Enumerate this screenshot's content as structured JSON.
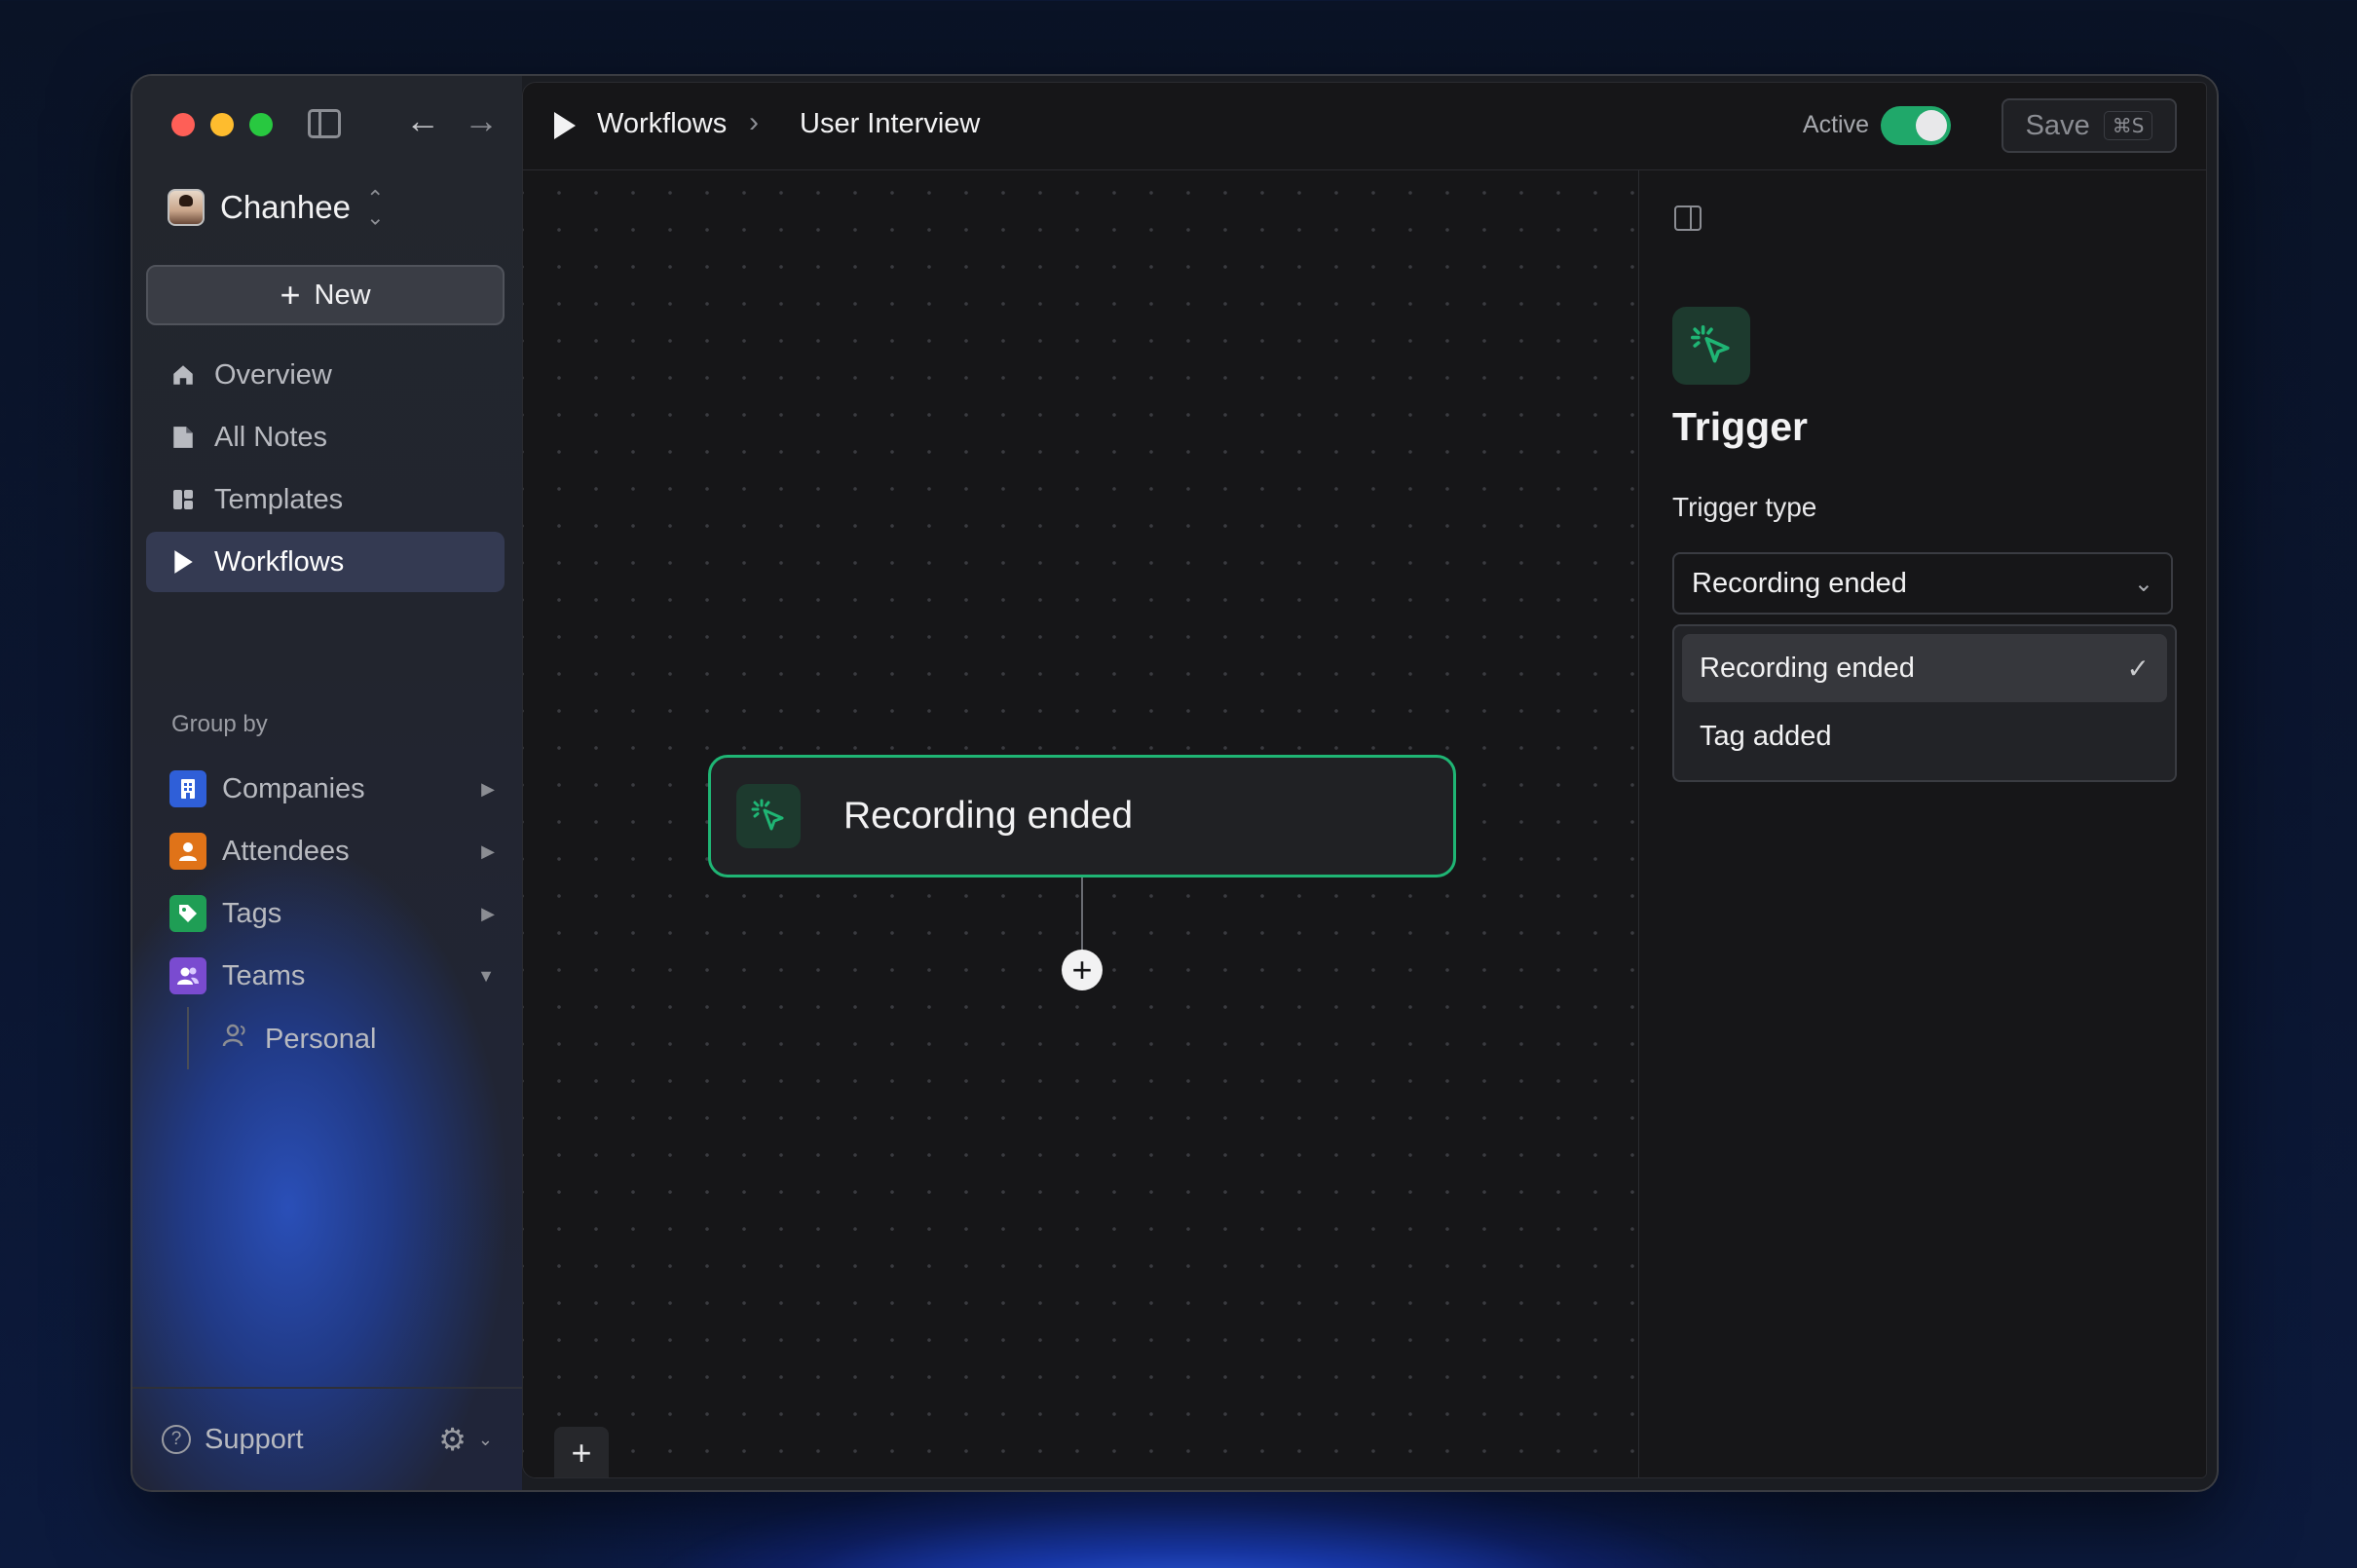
{
  "sidebar": {
    "user_name": "Chanhee",
    "new_label": "New",
    "nav": [
      {
        "label": "Overview",
        "icon": "home-icon"
      },
      {
        "label": "All Notes",
        "icon": "notes-icon"
      },
      {
        "label": "Templates",
        "icon": "templates-icon"
      },
      {
        "label": "Workflows",
        "icon": "play-icon",
        "active": true
      }
    ],
    "group_by_label": "Group by",
    "groups": [
      {
        "label": "Companies",
        "icon": "building-icon",
        "color": "#2f5fd8"
      },
      {
        "label": "Attendees",
        "icon": "person-icon",
        "color": "#e07318"
      },
      {
        "label": "Tags",
        "icon": "tag-icon",
        "color": "#1f9e55"
      },
      {
        "label": "Teams",
        "icon": "team-icon",
        "color": "#7a4bd0",
        "expanded": true
      }
    ],
    "teams_children": [
      {
        "label": "Personal",
        "icon": "person-outline-icon"
      }
    ],
    "support_label": "Support"
  },
  "topbar": {
    "crumb_root": "Workflows",
    "crumb_current": "User Interview",
    "active_label": "Active",
    "active_on": true,
    "save_label": "Save",
    "save_shortcut": "⌘S"
  },
  "canvas": {
    "node_label": "Recording ended",
    "zoom_in": "+",
    "zoom_out": "−",
    "add_symbol": "+"
  },
  "panel": {
    "title": "Trigger",
    "trigger_type_label": "Trigger type",
    "selected_value": "Recording ended",
    "options": [
      {
        "label": "Recording ended",
        "selected": true
      },
      {
        "label": "Tag added",
        "selected": false
      }
    ]
  },
  "colors": {
    "accent_green": "#1fb574",
    "toggle_on": "#20a86a"
  }
}
